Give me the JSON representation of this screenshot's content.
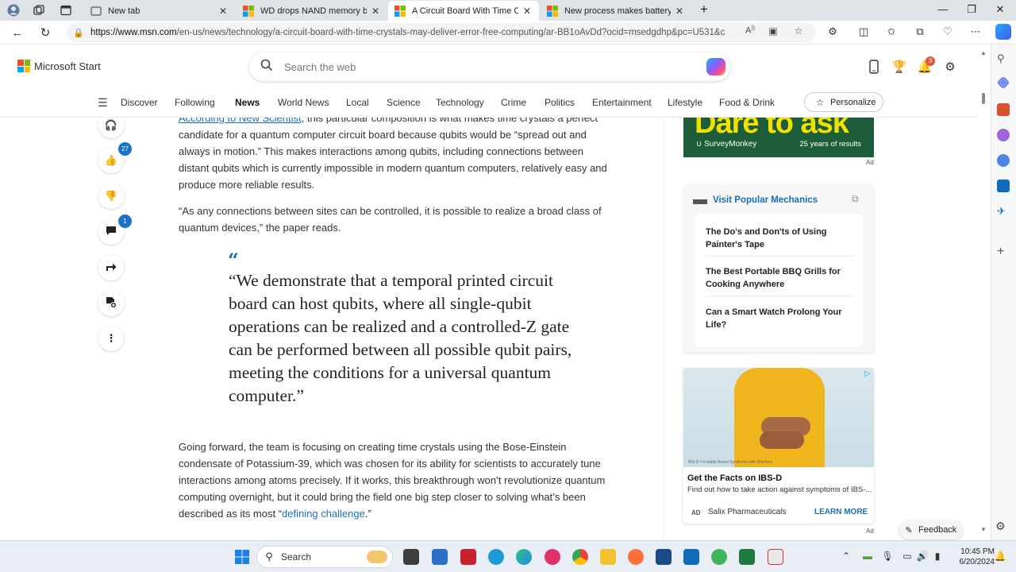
{
  "browser": {
    "tabs": [
      {
        "label": "New tab",
        "active": false
      },
      {
        "label": "WD drops NAND memory bomb",
        "active": false
      },
      {
        "label": "A Circuit Board With Time Crysta",
        "active": true
      },
      {
        "label": "New process makes battery prod",
        "active": false
      }
    ],
    "new_tab_label": "+",
    "url_host": "https://www.msn.com",
    "url_path": "/en-us/news/technology/a-circuit-board-with-time-crystals-may-deliver-error-free-computing/ar-BB1oAvDd?ocid=msedgdhp&pc=U531&c..."
  },
  "header": {
    "logo_text": "Microsoft Start",
    "search_placeholder": "Search the web",
    "notification_count": "3"
  },
  "nav": {
    "items": [
      "Discover",
      "Following",
      "News",
      "World News",
      "Local",
      "Science",
      "Technology",
      "Crime",
      "Politics",
      "Entertainment",
      "Lifestyle",
      "Food & Drink"
    ],
    "active": "News",
    "personalize_label": "Personalize"
  },
  "rail": {
    "likes_count": "27",
    "comments_count": "1"
  },
  "article": {
    "p1_link": "According to New Scientist",
    "p1_rest": ", this particular composition is what makes time crystals a perfect candidate for a quantum computer circuit board because qubits would be “spread out and always in motion.” This makes interactions among qubits, including connections between distant qubits which is currently impossible in modern quantum computers, relatively easy and produce more reliable results.",
    "p2": "“As any connections between sites can be controlled, it is possible to realize a broad class of quantum devices,” the paper reads.",
    "quote_mark": "“",
    "quote": "“We demonstrate that a temporal printed circuit board can host qubits, where all single-qubit operations can be realized and a controlled-Z gate can be performed between all possible qubit pairs, meeting the conditions for a universal quantum computer.”",
    "p3_text": "Going forward, the team is focusing on creating time crystals using the Bose-Einstein condensate of Potassium-39, which was chosen for its ability for scientists to accurately tune interactions among atoms precisely. If it works, this breakthrough won’t revolutionize quantum computing overnight, but it could bring the field one big step closer to solving what’s been described as its most “",
    "p3_link": "defining challenge",
    "p3_end": ".”"
  },
  "sidebar": {
    "ad_top_headline": "Dare to ask",
    "ad_top_brand": "SurveyMonkey",
    "ad_top_tagline": "25 years of results",
    "ad_label": "Ad",
    "pm_title": "Visit Popular Mechanics",
    "pm_items": [
      "The Do's and Don'ts of Using Painter's Tape",
      "The Best Portable BBQ Grills for Cooking Anywhere",
      "Can a Smart Watch Prolong Your Life?"
    ],
    "ad2_image_caption": "IBS-D = Irritable Bowel Syndrome with Diarrhea",
    "ad2_headline": "Get the Facts on IBS-D",
    "ad2_desc": "Find out how to take action against symptoms of IBS-...",
    "ad2_ad": "AD",
    "ad2_sponsor": "Salix Pharmaceuticals",
    "ad2_cta": "LEARN MORE",
    "feedback_label": "Feedback"
  },
  "taskbar": {
    "search_label": "Search",
    "time": "10:45 PM",
    "date": "6/20/2024"
  },
  "colors": {
    "link": "#1a6fb7",
    "badge": "#1a73c9",
    "notification": "#e0543a"
  }
}
